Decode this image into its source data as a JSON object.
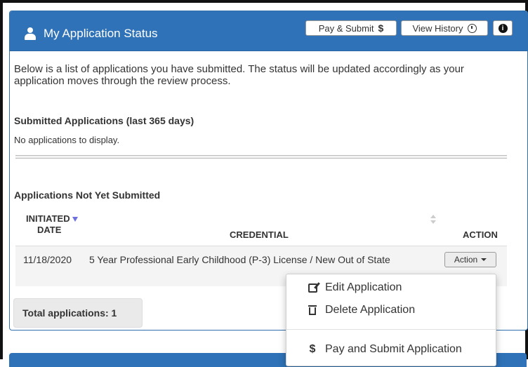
{
  "header": {
    "title": "My Application Status",
    "pay_submit_label": "Pay & Submit",
    "pay_submit_symbol": "$",
    "view_history_label": "View History",
    "info_symbol": "i"
  },
  "intro_text": "Below is a list of applications you have submitted. The status will be updated accordingly as your application moves through the review process.",
  "submitted": {
    "title": "Submitted Applications (last 365 days)",
    "empty_text": "No applications to display."
  },
  "not_submitted": {
    "title": "Applications Not Yet Submitted",
    "columns": {
      "date_line1": "INITIATED",
      "date_line2": "DATE",
      "credential": "CREDENTIAL",
      "action": "ACTION"
    },
    "rows": [
      {
        "date": "11/18/2020",
        "credential": "5 Year Professional Early Childhood (P-3) License / New Out of State",
        "action_label": "Action"
      }
    ],
    "total_label": "Total applications: 1"
  },
  "action_menu": {
    "items": [
      {
        "label": "Edit Application",
        "icon": "edit-icon"
      },
      {
        "label": "Delete Application",
        "icon": "trash-icon"
      },
      {
        "label": "Pay and Submit Application",
        "icon": "dollar-icon",
        "symbol": "$"
      }
    ]
  },
  "colors": {
    "header_blue": "#2f72b7",
    "sort_active": "#6f6fe0"
  }
}
